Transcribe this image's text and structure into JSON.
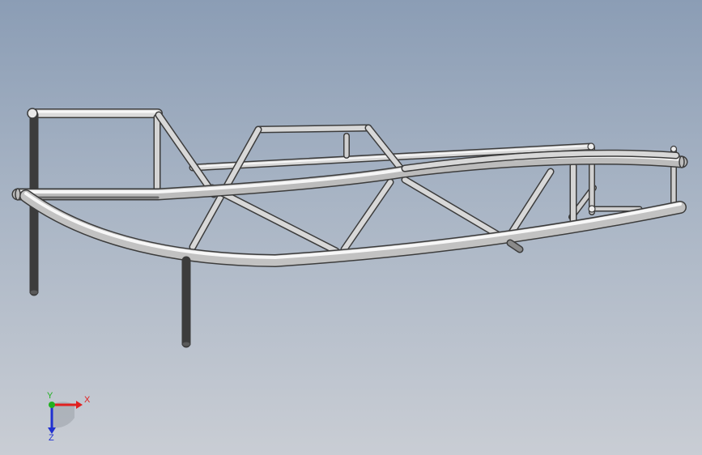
{
  "viewport": {
    "background_top": "#8b9db5",
    "background_bottom": "#c9cdd4"
  },
  "model": {
    "tube_color_light": "#f4f4f4",
    "tube_color_mid": "#bfbfbf",
    "tube_color_dark": "#6b6b6b",
    "outline_color": "#3c3c3c"
  },
  "triad": {
    "x_label": "X",
    "y_label": "Y",
    "z_label": "Z",
    "x_color": "#e02020",
    "y_color": "#20b020",
    "z_color": "#2030d0"
  }
}
